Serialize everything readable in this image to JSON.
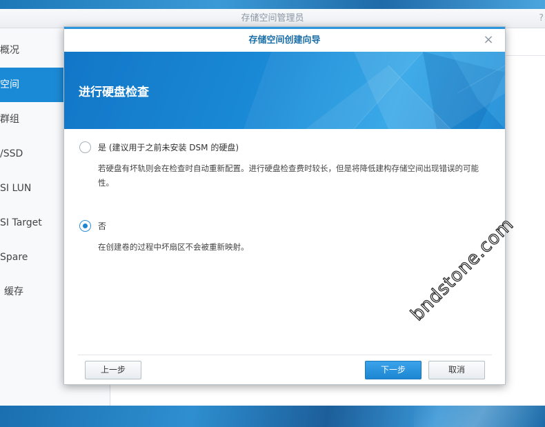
{
  "app": {
    "title": "存储空间管理员",
    "help_icon": "?"
  },
  "sidebar": {
    "items": [
      {
        "label": "概况",
        "active": false
      },
      {
        "label": "空间",
        "active": true
      },
      {
        "label": "群组",
        "active": false
      },
      {
        "label": "/SSD",
        "active": false
      },
      {
        "label": "SI LUN",
        "active": false
      },
      {
        "label": "SI Target",
        "active": false
      },
      {
        "label": "Spare",
        "active": false
      },
      {
        "label": "缓存",
        "active": false
      }
    ]
  },
  "wizard": {
    "title": "存储空间创建向导",
    "close_icon": "×",
    "banner_title": "进行硬盘检查",
    "options": [
      {
        "label": "是 (建议用于之前未安装 DSM 的硬盘)",
        "description": "若硬盘有坏轨则会在检查时自动重新配置。进行硬盘检查费时较长，但是将降低建构存储空间出现错误的可能性。",
        "checked": false
      },
      {
        "label": "否",
        "description": "在创建卷的过程中坏扇区不会被重新映射。",
        "checked": true
      }
    ],
    "buttons": {
      "back": "上一步",
      "next": "下一步",
      "cancel": "取消"
    }
  },
  "watermark": "bndstone.com",
  "colors": {
    "accent": "#1b8ad6",
    "banner": "#1a8ad6",
    "title_text": "#1a6ea8"
  }
}
